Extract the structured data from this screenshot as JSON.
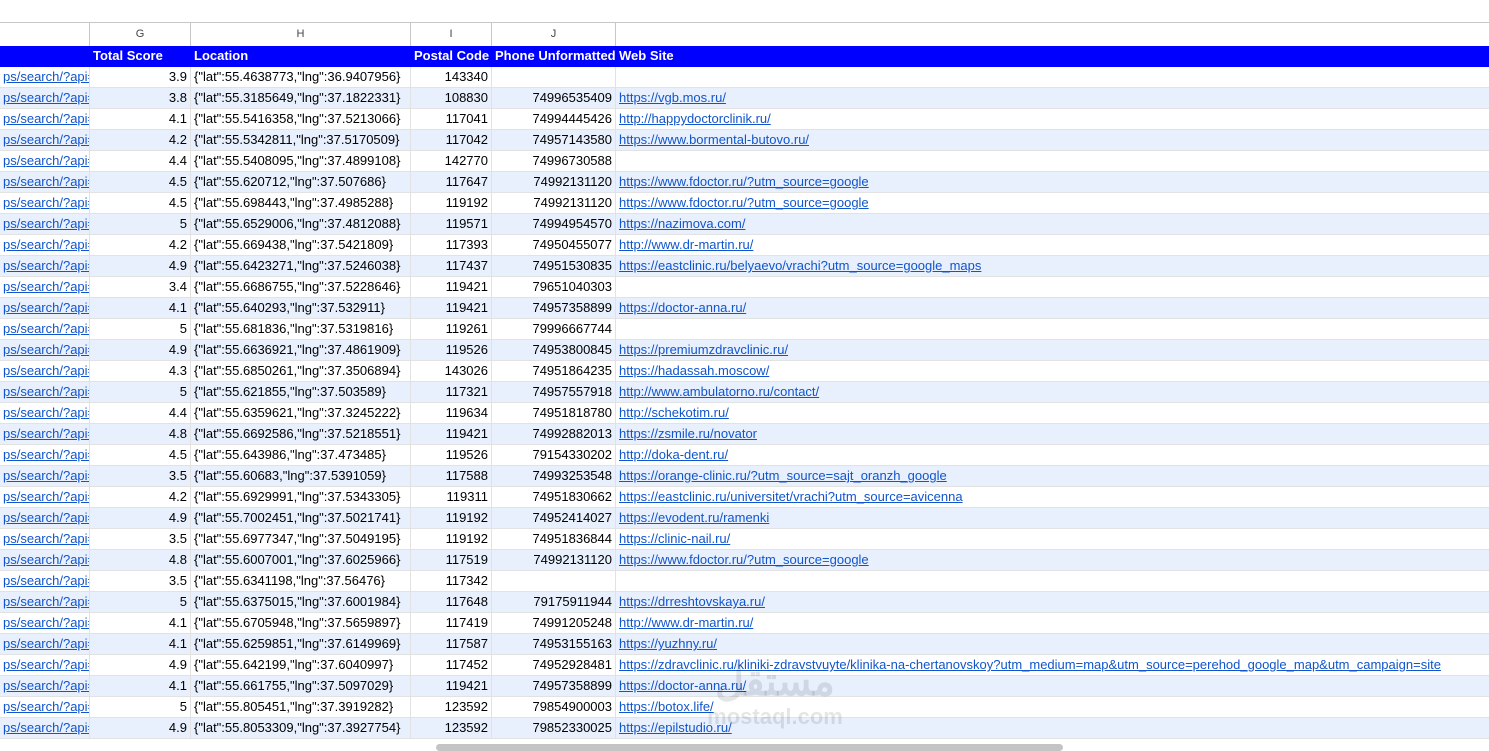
{
  "columns": [
    "G",
    "H",
    "I",
    "J"
  ],
  "header": {
    "total_score": "Total Score",
    "location": "Location",
    "postal_code": "Postal Code",
    "phone": "Phone Unformatted",
    "web_site": "Web Site"
  },
  "url_stub": "ps/search/?api=",
  "rows": [
    {
      "score": "3.9",
      "location": "{\"lat\":55.4638773,\"lng\":36.9407956}",
      "postal": "143340",
      "phone": "",
      "site": ""
    },
    {
      "score": "3.8",
      "location": "{\"lat\":55.3185649,\"lng\":37.1822331}",
      "postal": "108830",
      "phone": "74996535409",
      "site": "https://vgb.mos.ru/"
    },
    {
      "score": "4.1",
      "location": "{\"lat\":55.5416358,\"lng\":37.5213066}",
      "postal": "117041",
      "phone": "74994445426",
      "site": "http://happydoctorclinik.ru/"
    },
    {
      "score": "4.2",
      "location": "{\"lat\":55.5342811,\"lng\":37.5170509}",
      "postal": "117042",
      "phone": "74957143580",
      "site": "https://www.bormental-butovo.ru/"
    },
    {
      "score": "4.4",
      "location": "{\"lat\":55.5408095,\"lng\":37.4899108}",
      "postal": "142770",
      "phone": "74996730588",
      "site": ""
    },
    {
      "score": "4.5",
      "location": "{\"lat\":55.620712,\"lng\":37.507686}",
      "postal": "117647",
      "phone": "74992131120",
      "site": "https://www.fdoctor.ru/?utm_source=google"
    },
    {
      "score": "4.5",
      "location": "{\"lat\":55.698443,\"lng\":37.4985288}",
      "postal": "119192",
      "phone": "74992131120",
      "site": "https://www.fdoctor.ru/?utm_source=google"
    },
    {
      "score": "5",
      "location": "{\"lat\":55.6529006,\"lng\":37.4812088}",
      "postal": "119571",
      "phone": "74994954570",
      "site": "https://nazimova.com/"
    },
    {
      "score": "4.2",
      "location": "{\"lat\":55.669438,\"lng\":37.5421809}",
      "postal": "117393",
      "phone": "74950455077",
      "site": "http://www.dr-martin.ru/"
    },
    {
      "score": "4.9",
      "location": "{\"lat\":55.6423271,\"lng\":37.5246038}",
      "postal": "117437",
      "phone": "74951530835",
      "site": "https://eastclinic.ru/belyaevo/vrachi?utm_source=google_maps"
    },
    {
      "score": "3.4",
      "location": "{\"lat\":55.6686755,\"lng\":37.5228646}",
      "postal": "119421",
      "phone": "79651040303",
      "site": ""
    },
    {
      "score": "4.1",
      "location": "{\"lat\":55.640293,\"lng\":37.532911}",
      "postal": "119421",
      "phone": "74957358899",
      "site": "https://doctor-anna.ru/"
    },
    {
      "score": "5",
      "location": "{\"lat\":55.681836,\"lng\":37.5319816}",
      "postal": "119261",
      "phone": "79996667744",
      "site": ""
    },
    {
      "score": "4.9",
      "location": "{\"lat\":55.6636921,\"lng\":37.4861909}",
      "postal": "119526",
      "phone": "74953800845",
      "site": "https://premiumzdravclinic.ru/"
    },
    {
      "score": "4.3",
      "location": "{\"lat\":55.6850261,\"lng\":37.3506894}",
      "postal": "143026",
      "phone": "74951864235",
      "site": "https://hadassah.moscow/"
    },
    {
      "score": "5",
      "location": "{\"lat\":55.621855,\"lng\":37.503589}",
      "postal": "117321",
      "phone": "74957557918",
      "site": "http://www.ambulatorno.ru/contact/"
    },
    {
      "score": "4.4",
      "location": "{\"lat\":55.6359621,\"lng\":37.3245222}",
      "postal": "119634",
      "phone": "74951818780",
      "site": "http://schekotim.ru/"
    },
    {
      "score": "4.8",
      "location": "{\"lat\":55.6692586,\"lng\":37.5218551}",
      "postal": "119421",
      "phone": "74992882013",
      "site": "https://zsmile.ru/novator"
    },
    {
      "score": "4.5",
      "location": "{\"lat\":55.643986,\"lng\":37.473485}",
      "postal": "119526",
      "phone": "79154330202",
      "site": "http://doka-dent.ru/"
    },
    {
      "score": "3.5",
      "location": "{\"lat\":55.60683,\"lng\":37.5391059}",
      "postal": "117588",
      "phone": "74993253548",
      "site": "https://orange-clinic.ru/?utm_source=sajt_oranzh_google"
    },
    {
      "score": "4.2",
      "location": "{\"lat\":55.6929991,\"lng\":37.5343305}",
      "postal": "119311",
      "phone": "74951830662",
      "site": "https://eastclinic.ru/universitet/vrachi?utm_source=avicenna"
    },
    {
      "score": "4.9",
      "location": "{\"lat\":55.7002451,\"lng\":37.5021741}",
      "postal": "119192",
      "phone": "74952414027",
      "site": "https://evodent.ru/ramenki"
    },
    {
      "score": "3.5",
      "location": "{\"lat\":55.6977347,\"lng\":37.5049195}",
      "postal": "119192",
      "phone": "74951836844",
      "site": "https://clinic-nail.ru/"
    },
    {
      "score": "4.8",
      "location": "{\"lat\":55.6007001,\"lng\":37.6025966}",
      "postal": "117519",
      "phone": "74992131120",
      "site": "https://www.fdoctor.ru/?utm_source=google"
    },
    {
      "score": "3.5",
      "location": "{\"lat\":55.6341198,\"lng\":37.56476}",
      "postal": "117342",
      "phone": "",
      "site": ""
    },
    {
      "score": "5",
      "location": "{\"lat\":55.6375015,\"lng\":37.6001984}",
      "postal": "117648",
      "phone": "79175911944",
      "site": "https://drreshtovskaya.ru/"
    },
    {
      "score": "4.1",
      "location": "{\"lat\":55.6705948,\"lng\":37.5659897}",
      "postal": "117419",
      "phone": "74991205248",
      "site": "http://www.dr-martin.ru/"
    },
    {
      "score": "4.1",
      "location": "{\"lat\":55.6259851,\"lng\":37.6149969}",
      "postal": "117587",
      "phone": "74953155163",
      "site": "https://yuzhny.ru/"
    },
    {
      "score": "4.9",
      "location": "{\"lat\":55.642199,\"lng\":37.6040997}",
      "postal": "117452",
      "phone": "74952928481",
      "site": "https://zdravclinic.ru/kliniki-zdravstvuyte/klinika-na-chertanovskoy?utm_medium=map&utm_source=perehod_google_map&utm_campaign=site"
    },
    {
      "score": "4.1",
      "location": "{\"lat\":55.661755,\"lng\":37.5097029}",
      "postal": "119421",
      "phone": "74957358899",
      "site": "https://doctor-anna.ru/"
    },
    {
      "score": "5",
      "location": "{\"lat\":55.805451,\"lng\":37.3919282}",
      "postal": "123592",
      "phone": "79854900003",
      "site": "https://botox.life/"
    },
    {
      "score": "4.9",
      "location": "{\"lat\":55.8053309,\"lng\":37.3927754}",
      "postal": "123592",
      "phone": "79852330025",
      "site": "https://epilstudio.ru/"
    }
  ],
  "watermark": {
    "line1": "مستقل",
    "line2": "mostaql.com"
  }
}
